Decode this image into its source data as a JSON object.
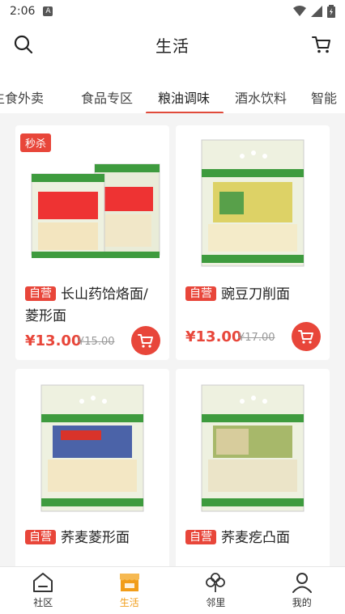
{
  "status": {
    "time": "2:06",
    "notif_icon": "A"
  },
  "header": {
    "title": "生活"
  },
  "tabs": [
    {
      "label": "生食外卖"
    },
    {
      "label": "食品专区"
    },
    {
      "label": "粮油调味"
    },
    {
      "label": "酒水饮料"
    },
    {
      "label": "智能"
    }
  ],
  "products": [
    {
      "flash_badge": "秒杀",
      "tag": "自营",
      "name_l1": "长山药饸烙面/",
      "name_l2": "菱形面",
      "price": "¥13.00",
      "old_price": "¥15.00"
    },
    {
      "tag": "自营",
      "name_l1": "豌豆刀削面",
      "price": "¥13.00",
      "old_price": "¥17.00"
    },
    {
      "tag": "自营",
      "name_l1": "荞麦菱形面"
    },
    {
      "tag": "自营",
      "name_l1": "荞麦疙凸面"
    }
  ],
  "nav": [
    {
      "label": "社区"
    },
    {
      "label": "生活"
    },
    {
      "label": "邻里"
    },
    {
      "label": "我的"
    }
  ],
  "colors": {
    "accent": "#e8463a",
    "nav_active": "#f19d1a"
  }
}
